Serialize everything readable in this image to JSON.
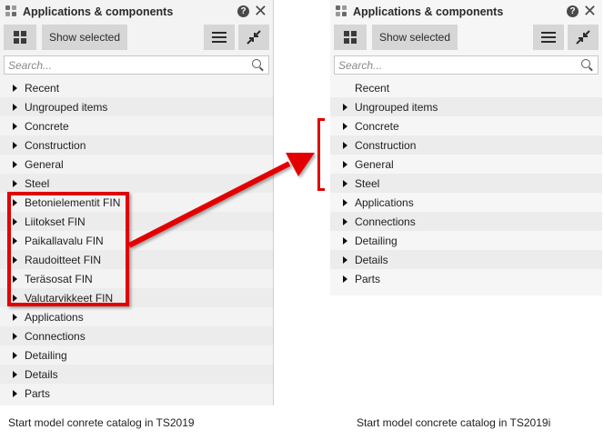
{
  "left_panel": {
    "title": "Applications & components",
    "help_label": "?",
    "show_selected_label": "Show selected",
    "search_placeholder": "Search...",
    "items": [
      {
        "label": "Recent",
        "expandable": true
      },
      {
        "label": "Ungrouped items",
        "expandable": true
      },
      {
        "label": "Concrete",
        "expandable": true
      },
      {
        "label": "Construction",
        "expandable": true
      },
      {
        "label": "General",
        "expandable": true
      },
      {
        "label": "Steel",
        "expandable": true
      },
      {
        "label": "Betonielementit FIN",
        "expandable": true
      },
      {
        "label": "Liitokset FIN",
        "expandable": true
      },
      {
        "label": "Paikallavalu FIN",
        "expandable": true
      },
      {
        "label": "Raudoitteet FIN",
        "expandable": true
      },
      {
        "label": "Teräsosat FIN",
        "expandable": true
      },
      {
        "label": "Valutarvikkeet FIN",
        "expandable": true
      },
      {
        "label": "Applications",
        "expandable": true
      },
      {
        "label": "Connections",
        "expandable": true
      },
      {
        "label": "Detailing",
        "expandable": true
      },
      {
        "label": "Details",
        "expandable": true
      },
      {
        "label": "Parts",
        "expandable": true
      }
    ]
  },
  "right_panel": {
    "title": "Applications & components",
    "help_label": "?",
    "show_selected_label": "Show selected",
    "search_placeholder": "Search...",
    "items": [
      {
        "label": "Recent",
        "expandable": false
      },
      {
        "label": "Ungrouped items",
        "expandable": true
      },
      {
        "label": "Concrete",
        "expandable": true
      },
      {
        "label": "Construction",
        "expandable": true
      },
      {
        "label": "General",
        "expandable": true
      },
      {
        "label": "Steel",
        "expandable": true
      },
      {
        "label": "Applications",
        "expandable": true
      },
      {
        "label": "Connections",
        "expandable": true
      },
      {
        "label": "Detailing",
        "expandable": true
      },
      {
        "label": "Details",
        "expandable": true
      },
      {
        "label": "Parts",
        "expandable": true
      }
    ]
  },
  "captions": {
    "left": "Start model conrete catalog in TS2019",
    "right": "Start model concrete catalog in TS2019i"
  },
  "colors": {
    "highlight": "#e20000",
    "panel_bg": "#f3f3f3",
    "button_bg": "#d6d6d6"
  },
  "icons": [
    "app-grid-icon",
    "help-icon",
    "close-icon",
    "thumbnail-view-icon",
    "list-view-icon",
    "collapse-icon",
    "search-icon",
    "expand-triangle-icon"
  ]
}
